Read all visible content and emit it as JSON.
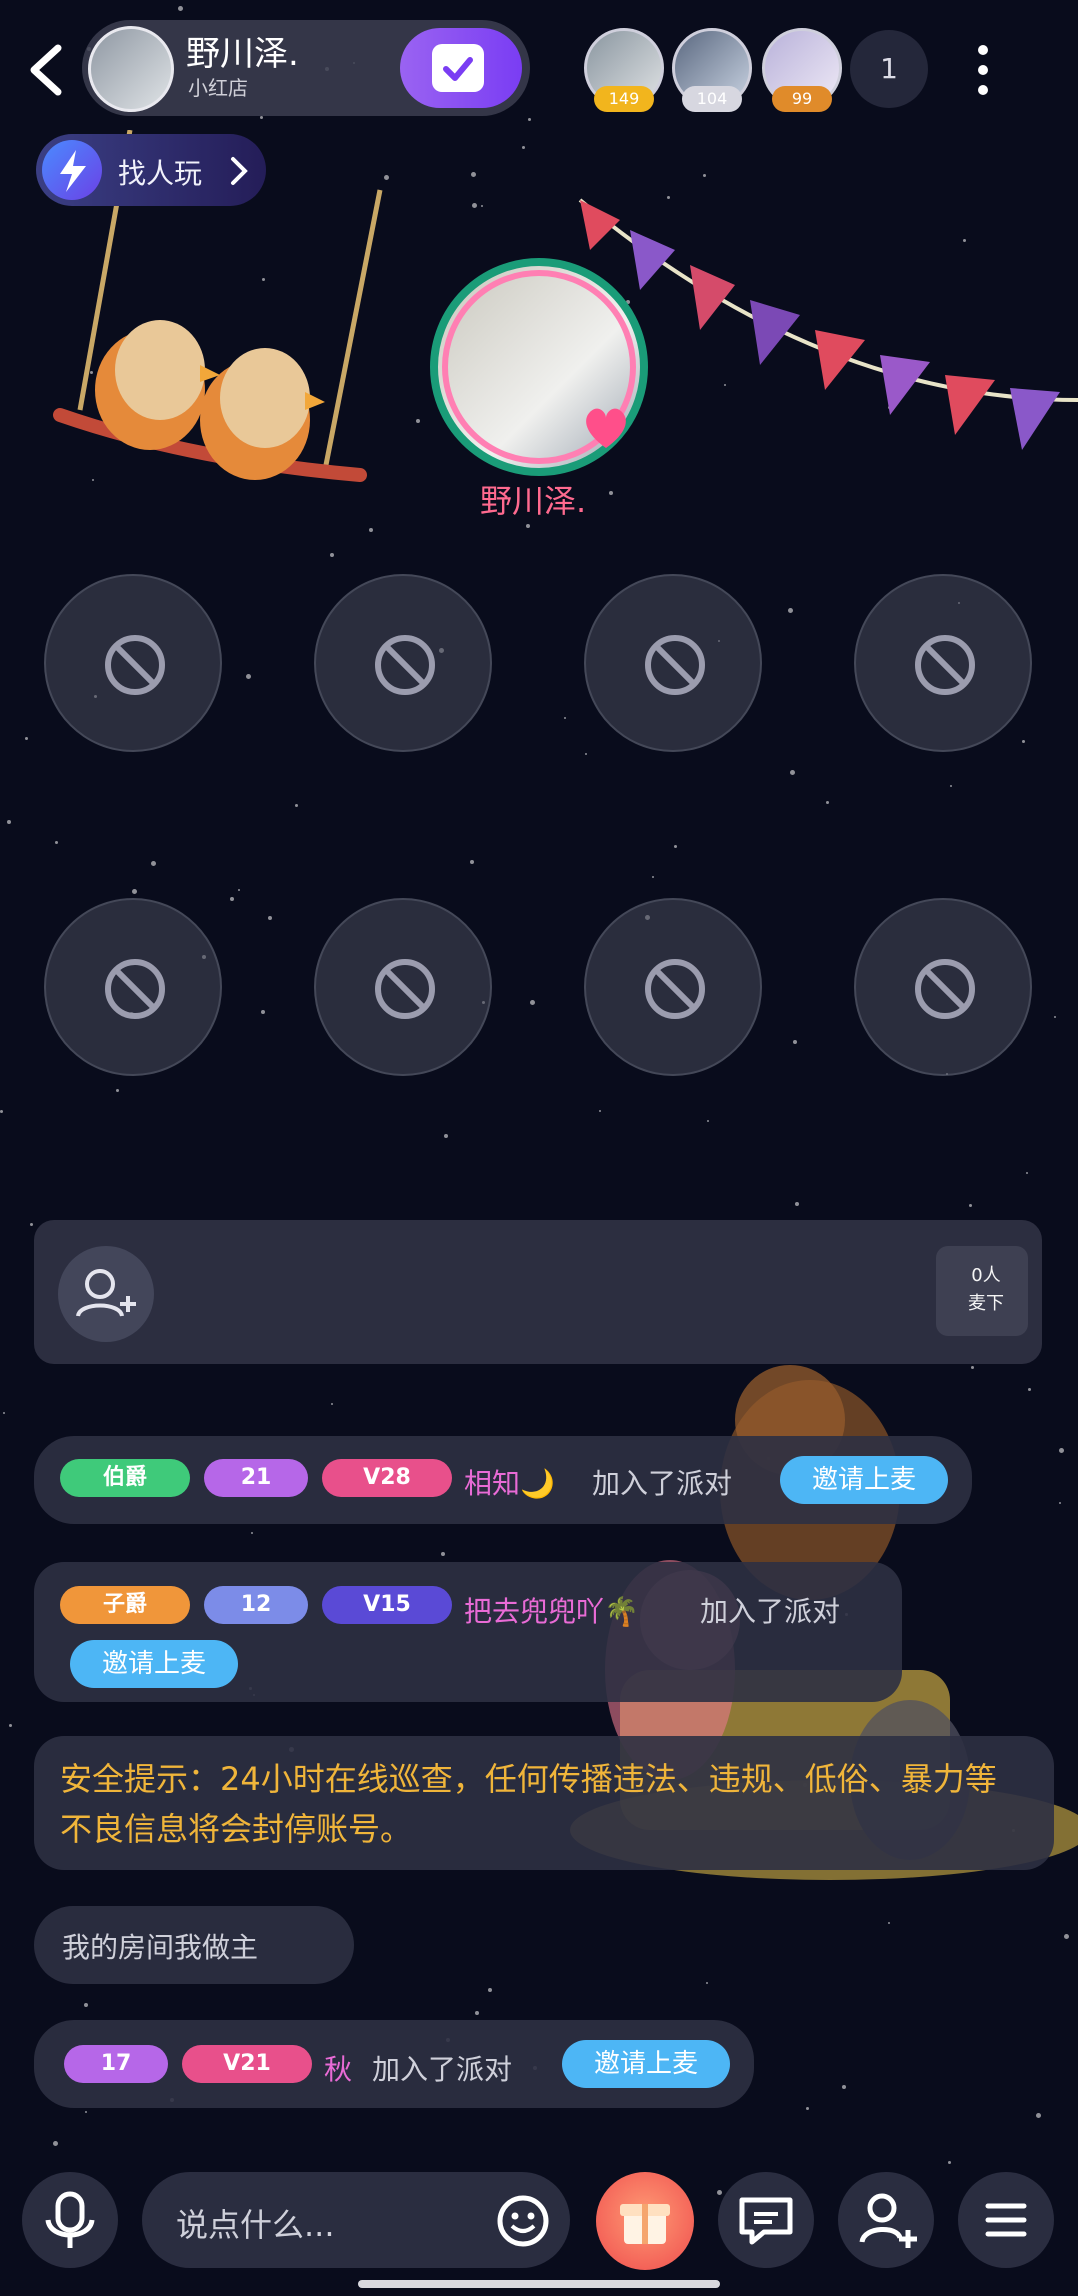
{
  "host": {
    "name": "野川泽.",
    "subtitle": "小红店"
  },
  "viewers": [
    {
      "badge": "149",
      "badge_color": "#f2b51d"
    },
    {
      "badge": "104",
      "badge_color": "#d7d7e0"
    },
    {
      "badge": "99",
      "badge_color": "#e08b2a"
    }
  ],
  "viewer_count": "1",
  "find_players": {
    "label": "找人玩"
  },
  "stage": {
    "name": "野川泽."
  },
  "seats": [
    {
      "state": "locked"
    },
    {
      "state": "locked"
    },
    {
      "state": "locked"
    },
    {
      "state": "locked"
    },
    {
      "state": "locked"
    },
    {
      "state": "locked"
    },
    {
      "state": "locked"
    },
    {
      "state": "locked"
    }
  ],
  "mic_control": {
    "line1": "0人",
    "line2": "麦下"
  },
  "chat": [
    {
      "type": "join",
      "rank_badge": "伯爵",
      "rank_color": "#3fca7a",
      "level": "21",
      "vip": "V28",
      "user": "相知🌙",
      "action": "加入了派对",
      "invite": "邀请上麦"
    },
    {
      "type": "join",
      "rank_badge": "子爵",
      "rank_color": "#f0963a",
      "level": "12",
      "vip": "V15",
      "user": "把去兜兜吖🌴",
      "action": "加入了派对",
      "invite": "邀请上麦"
    },
    {
      "type": "system",
      "text": "安全提示：24小时在线巡查，任何传播违法、违规、低俗、暴力等不良信息将会封停账号。"
    },
    {
      "type": "text",
      "text": "我的房间我做主"
    },
    {
      "type": "join",
      "level": "17",
      "vip": "V21",
      "user": "秋",
      "action": "加入了派对",
      "invite": "邀请上麦"
    }
  ],
  "input": {
    "placeholder": "说点什么..."
  },
  "colors": {
    "accent": "#7a3df3",
    "invite": "#4db6f5",
    "safety": "#f0b53a",
    "username_pink": "#e96bd6"
  }
}
